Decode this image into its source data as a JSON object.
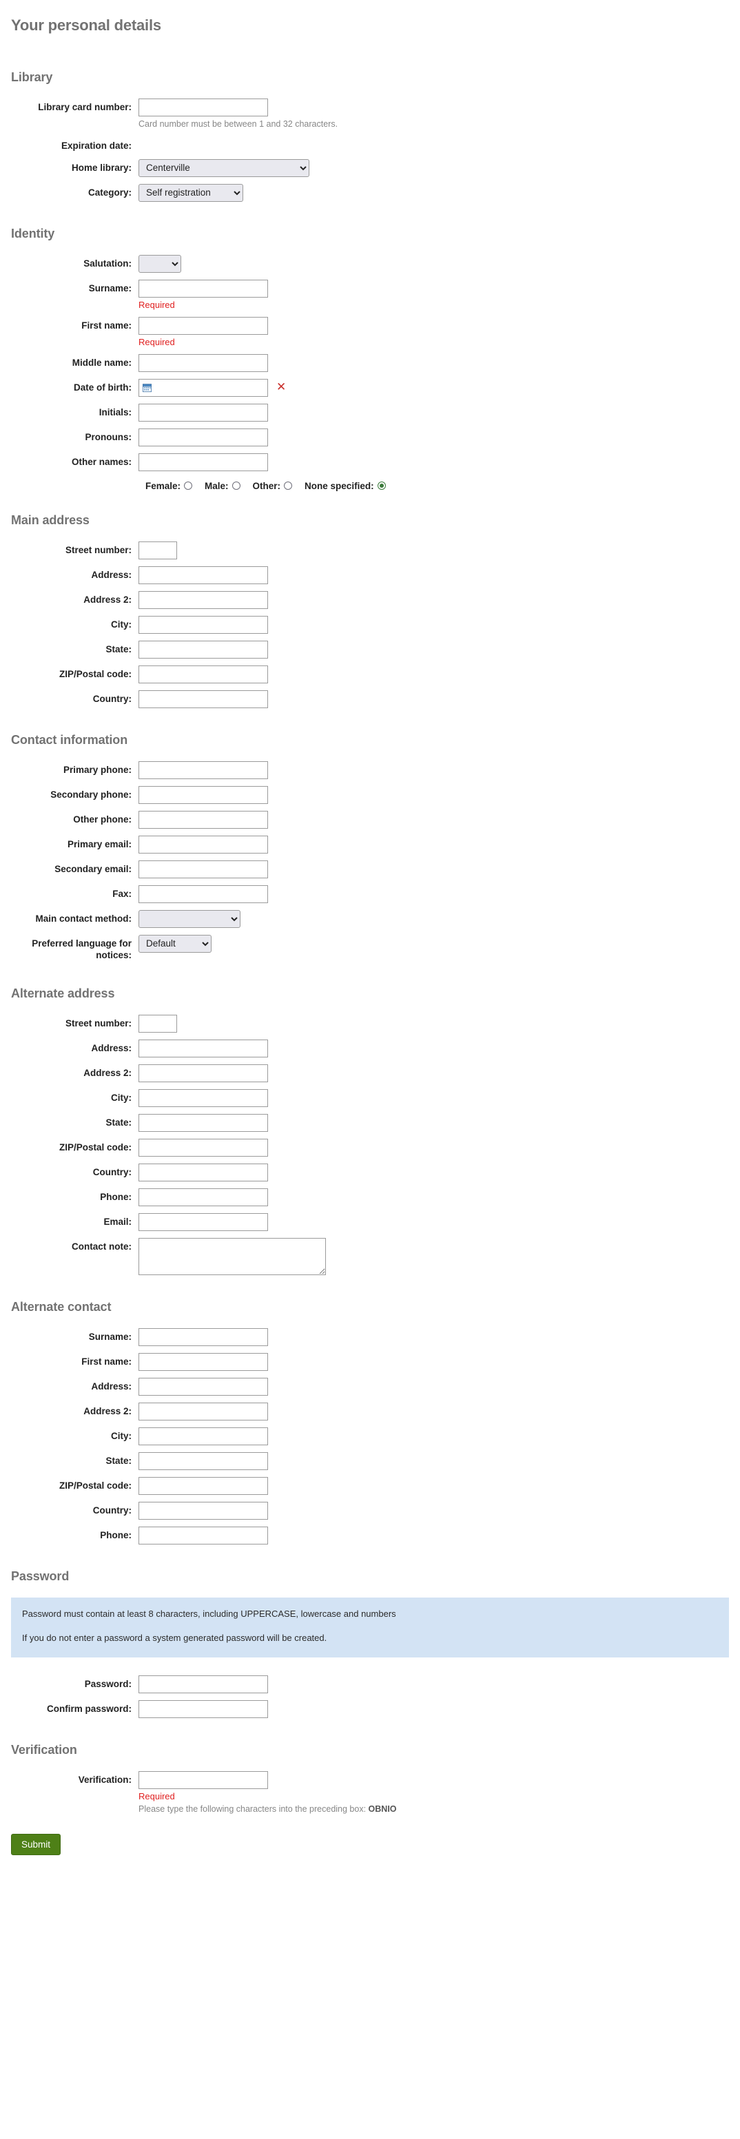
{
  "page": {
    "title": "Your personal details"
  },
  "sections": {
    "library": {
      "title": "Library",
      "card_label": "Library card number:",
      "card_hint": "Card number must be between 1 and 32 characters.",
      "expiration_label": "Expiration date:",
      "home_library_label": "Home library:",
      "home_library_value": "Centerville",
      "category_label": "Category:",
      "category_value": "Self registration"
    },
    "identity": {
      "title": "Identity",
      "salutation_label": "Salutation:",
      "salutation_value": "",
      "surname_label": "Surname:",
      "surname_required": "Required",
      "firstname_label": "First name:",
      "firstname_required": "Required",
      "middlename_label": "Middle name:",
      "dob_label": "Date of birth:",
      "dob_value": "",
      "dob_clear": "✕",
      "initials_label": "Initials:",
      "pronouns_label": "Pronouns:",
      "othernames_label": "Other names:",
      "gender": {
        "female_label": "Female:",
        "male_label": "Male:",
        "other_label": "Other:",
        "none_label": "None specified:",
        "selected": "none"
      }
    },
    "main_address": {
      "title": "Main address",
      "fields": [
        {
          "label": "Street number:",
          "size": "short"
        },
        {
          "label": "Address:",
          "size": "long"
        },
        {
          "label": "Address 2:",
          "size": "long"
        },
        {
          "label": "City:",
          "size": "long"
        },
        {
          "label": "State:",
          "size": "long"
        },
        {
          "label": "ZIP/Postal code:",
          "size": "long"
        },
        {
          "label": "Country:",
          "size": "long"
        }
      ]
    },
    "contact_information": {
      "title": "Contact information",
      "fields": [
        {
          "label": "Primary phone:",
          "size": "long"
        },
        {
          "label": "Secondary phone:",
          "size": "long"
        },
        {
          "label": "Other phone:",
          "size": "long"
        },
        {
          "label": "Primary email:",
          "size": "long"
        },
        {
          "label": "Secondary email:",
          "size": "long"
        },
        {
          "label": "Fax:",
          "size": "long"
        }
      ],
      "main_contact_label": "Main contact method:",
      "main_contact_value": "",
      "language_label": "Preferred language for notices:",
      "language_value": "Default"
    },
    "alternate_address": {
      "title": "Alternate address",
      "fields": [
        {
          "label": "Street number:",
          "size": "short"
        },
        {
          "label": "Address:",
          "size": "long"
        },
        {
          "label": "Address 2:",
          "size": "long"
        },
        {
          "label": "City:",
          "size": "long"
        },
        {
          "label": "State:",
          "size": "long"
        },
        {
          "label": "ZIP/Postal code:",
          "size": "long"
        },
        {
          "label": "Country:",
          "size": "long"
        },
        {
          "label": "Phone:",
          "size": "long"
        },
        {
          "label": "Email:",
          "size": "long"
        }
      ],
      "contact_note_label": "Contact note:",
      "contact_note_value": ""
    },
    "alternate_contact": {
      "title": "Alternate contact",
      "fields": [
        {
          "label": "Surname:",
          "size": "long"
        },
        {
          "label": "First name:",
          "size": "long"
        },
        {
          "label": "Address:",
          "size": "long"
        },
        {
          "label": "Address 2:",
          "size": "long"
        },
        {
          "label": "City:",
          "size": "long"
        },
        {
          "label": "State:",
          "size": "long"
        },
        {
          "label": "ZIP/Postal code:",
          "size": "long"
        },
        {
          "label": "Country:",
          "size": "long"
        },
        {
          "label": "Phone:",
          "size": "long"
        }
      ]
    },
    "password": {
      "title": "Password",
      "note_line_1": "Password must contain at least 8 characters, including UPPERCASE, lowercase and numbers",
      "note_line_2": "If you do not enter a password a system generated password will be created.",
      "password_label": "Password:",
      "confirm_label": "Confirm password:"
    },
    "verification": {
      "title": "Verification",
      "label": "Verification:",
      "required": "Required",
      "hint_prefix": "Please type the following characters into the preceding box:",
      "code": "OBNIO"
    }
  },
  "submit": {
    "label": "Submit"
  },
  "colors": {
    "heading": "#727272",
    "required_red": "#e02020",
    "note_bg": "#d3e3f4",
    "submit_green": "#4e8017",
    "radio_green": "#3a7a3a"
  }
}
